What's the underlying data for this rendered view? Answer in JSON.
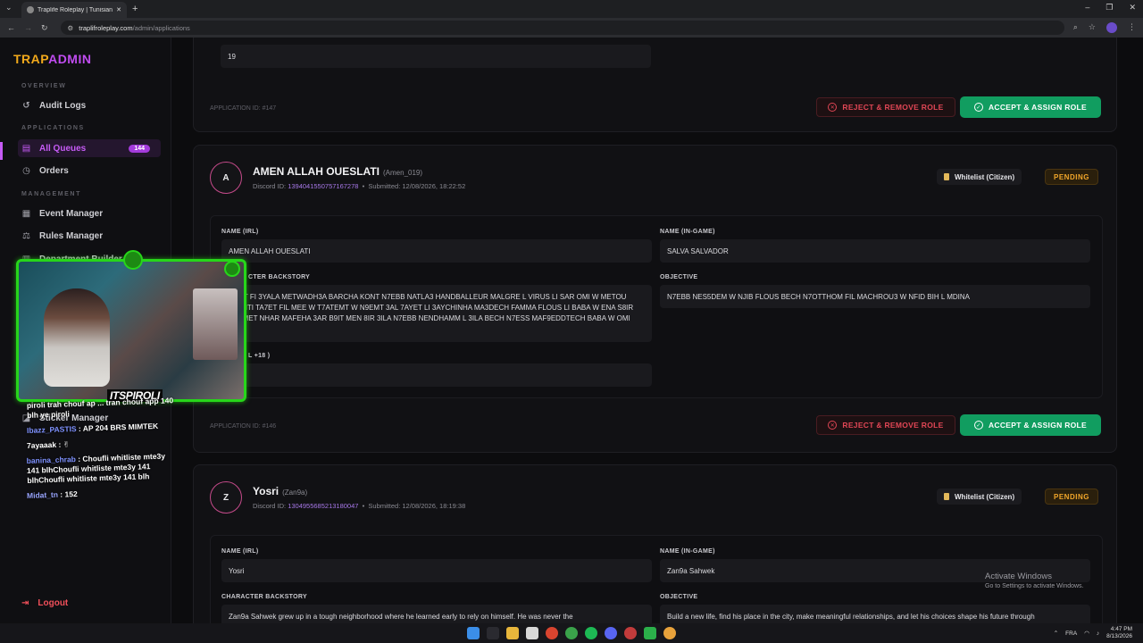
{
  "browser": {
    "tab_title": "Traplife Roleplay | Tunisian GTA",
    "url_host": "traplifroleplay.com",
    "url_path": "/admin/applications"
  },
  "sidebar": {
    "logo_a": "TRAP",
    "logo_b": "ADMIN",
    "sections": {
      "overview": "OVERVIEW",
      "applications": "APPLICATIONS",
      "management": "MANAGEMENT"
    },
    "items": [
      {
        "label": "Audit Logs",
        "icon": "history-icon"
      },
      {
        "label": "All Queues",
        "icon": "document-icon",
        "badge": "144"
      },
      {
        "label": "Orders",
        "icon": "clock-icon"
      },
      {
        "label": "Event Manager",
        "icon": "calendar-icon"
      },
      {
        "label": "Rules Manager",
        "icon": "scale-icon"
      },
      {
        "label": "Department Builder",
        "icon": "building-icon"
      },
      {
        "label": "Sticker Manager",
        "icon": "sticker-icon"
      }
    ],
    "logout": "Logout"
  },
  "prev_card": {
    "field_value": "19",
    "app_id": "APPLICATION ID: #147",
    "reject": "REJECT & REMOVE ROLE",
    "accept": "ACCEPT & ASSIGN ROLE"
  },
  "card1": {
    "avatar": "A",
    "name": "AMEN ALLAH OUESLATI",
    "handle": "(Amen_019)",
    "discord_label": "Discord ID:",
    "discord_id": "1394041550757167278",
    "submitted": "Submitted: 12/08/2026, 18:22:52",
    "role": "Whitelist (Citizen)",
    "status": "PENDING",
    "name_irl_label": "NAME (IRL)",
    "name_irl": "AMEN ALLAH OUESLATI",
    "name_ig_label": "NAME (IN-GAME)",
    "name_ig": "SALVA SALVADOR",
    "backstory_label": "CTER BACKSTORY",
    "backstory": "ECHT FI 3YALA METWADH3A BARCHA KONT N7EBB NATLA3 HANDBALLEUR  MALGRE L VIRUS LI SAR OMI W METOU  7ELMTI TA7ET FIL MEE W T7ATEMT W N9EMT 3AL 7AYET   LI 3AYCHINHA MA3DECH FAMMA FLOUS LI BABA W ENA S8IR 5EDMET NHAR MAFEHA 3AR B9IT MEN 8IR 3ILA N7EBB NENDHAMM L 3ILA BECH N7ESS MAF9EDDTECH BABA W OMI",
    "objective_label": "OBJECTIVE",
    "objective": "N7EBB NES5DEM W NJIB FLOUS BECH N7OTTHOM FIL MACHROU3 W NFID BIH L MDINA",
    "age_label": "L +18 )",
    "age": "",
    "app_id": "APPLICATION ID: #146",
    "reject": "REJECT & REMOVE ROLE",
    "accept": "ACCEPT & ASSIGN ROLE"
  },
  "card2": {
    "avatar": "Z",
    "name": "Yosri",
    "handle": "(Zan9a)",
    "discord_label": "Discord ID:",
    "discord_id": "1304955685213180047",
    "submitted": "Submitted: 12/08/2026, 18:19:38",
    "role": "Whitelist (Citizen)",
    "status": "PENDING",
    "name_irl_label": "NAME (IRL)",
    "name_irl": "Yosri",
    "name_ig_label": "NAME (IN-GAME)",
    "name_ig": "Zan9a Sahwek",
    "backstory_label": "CHARACTER BACKSTORY",
    "backstory": "Zan9a Sahwek grew up in a tough neighborhood where he learned early to rely on himself. He was never the",
    "objective_label": "OBJECTIVE",
    "objective": "Build a new life, find his place in the city, make meaningful relationships, and let his choices shape his future through"
  },
  "overlay": {
    "streamer": "ITSPIROLI",
    "chat": [
      {
        "user": "",
        "text": "piroli trah chouf ap ... tran chouf app 140 blh ye piroli"
      },
      {
        "user": "Ibazz_PASTIS",
        "text": " : AP 204 BRS MIMTEK"
      },
      {
        "user": "",
        "text": "7ayaaak : ✌"
      },
      {
        "user": "banina_chrab",
        "text": " : Choufli whitliste mte3y 141 blhChoufli whitliste mte3y 141 blhChoufli whitliste mte3y 141 blh"
      },
      {
        "user": "Midat_tn",
        "text": " : 152"
      }
    ]
  },
  "windows": {
    "activate_title": "Activate Windows",
    "activate_sub": "Go to Settings to activate Windows.",
    "lang": "FRA",
    "time": "4:47 PM",
    "date": "8/13/2026"
  }
}
